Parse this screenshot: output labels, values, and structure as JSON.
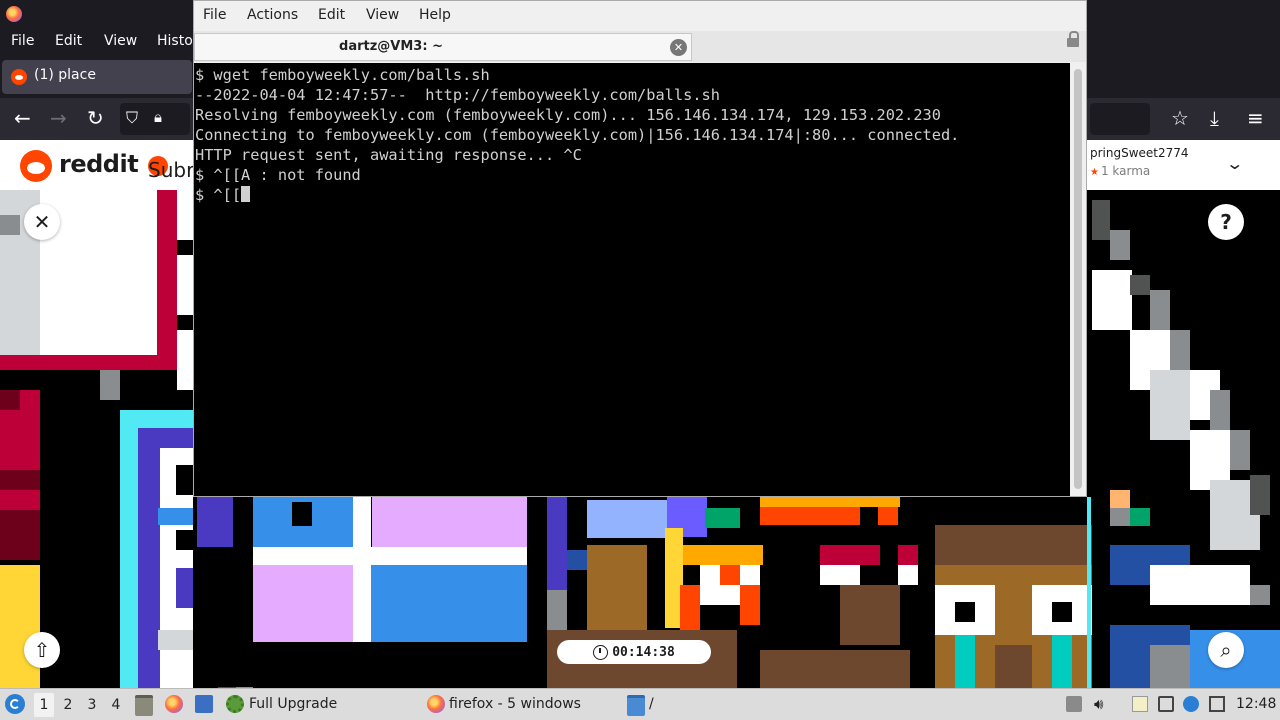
{
  "firefox": {
    "menu": [
      "File",
      "Edit",
      "View",
      "Histo"
    ],
    "tab_title": "(1) place",
    "nav_icons": [
      "back-icon",
      "forward-icon",
      "reload-icon",
      "shield-icon",
      "lock-icon",
      "star-icon",
      "download-icon",
      "menu-icon"
    ]
  },
  "reddit": {
    "brand": "reddit",
    "sub_partial": "Subr",
    "username": "pringSweet2774",
    "karma": "1 karma",
    "timer": "00:14:38",
    "buttons": [
      "close-icon",
      "help-icon",
      "share-icon",
      "zoom-icon"
    ]
  },
  "terminal": {
    "menu": [
      "File",
      "Actions",
      "Edit",
      "View",
      "Help"
    ],
    "tab_title": "dartz@VM3: ~",
    "lines": [
      "$ wget femboyweekly.com/balls.sh",
      "--2022-04-04 12:47:57--  http://femboyweekly.com/balls.sh",
      "Resolving femboyweekly.com (femboyweekly.com)... 156.146.134.174, 129.153.202.230",
      "Connecting to femboyweekly.com (femboyweekly.com)|156.146.134.174|:80... connected.",
      "HTTP request sent, awaiting response... ^C",
      "$ ^[[A : not found"
    ],
    "prompt": "$ ^[["
  },
  "taskbar": {
    "workspaces": [
      "1",
      "2",
      "3",
      "4"
    ],
    "active_workspace": "1",
    "tasks": [
      "Full Upgrade",
      "firefox - 5 windows",
      "/"
    ],
    "clock": "12:48"
  },
  "colors": {
    "terminal_bg": "#000000",
    "terminal_fg": "#d0d0d0",
    "reddit_orange": "#ff4500",
    "firefox_dark": "#1c1b22"
  }
}
